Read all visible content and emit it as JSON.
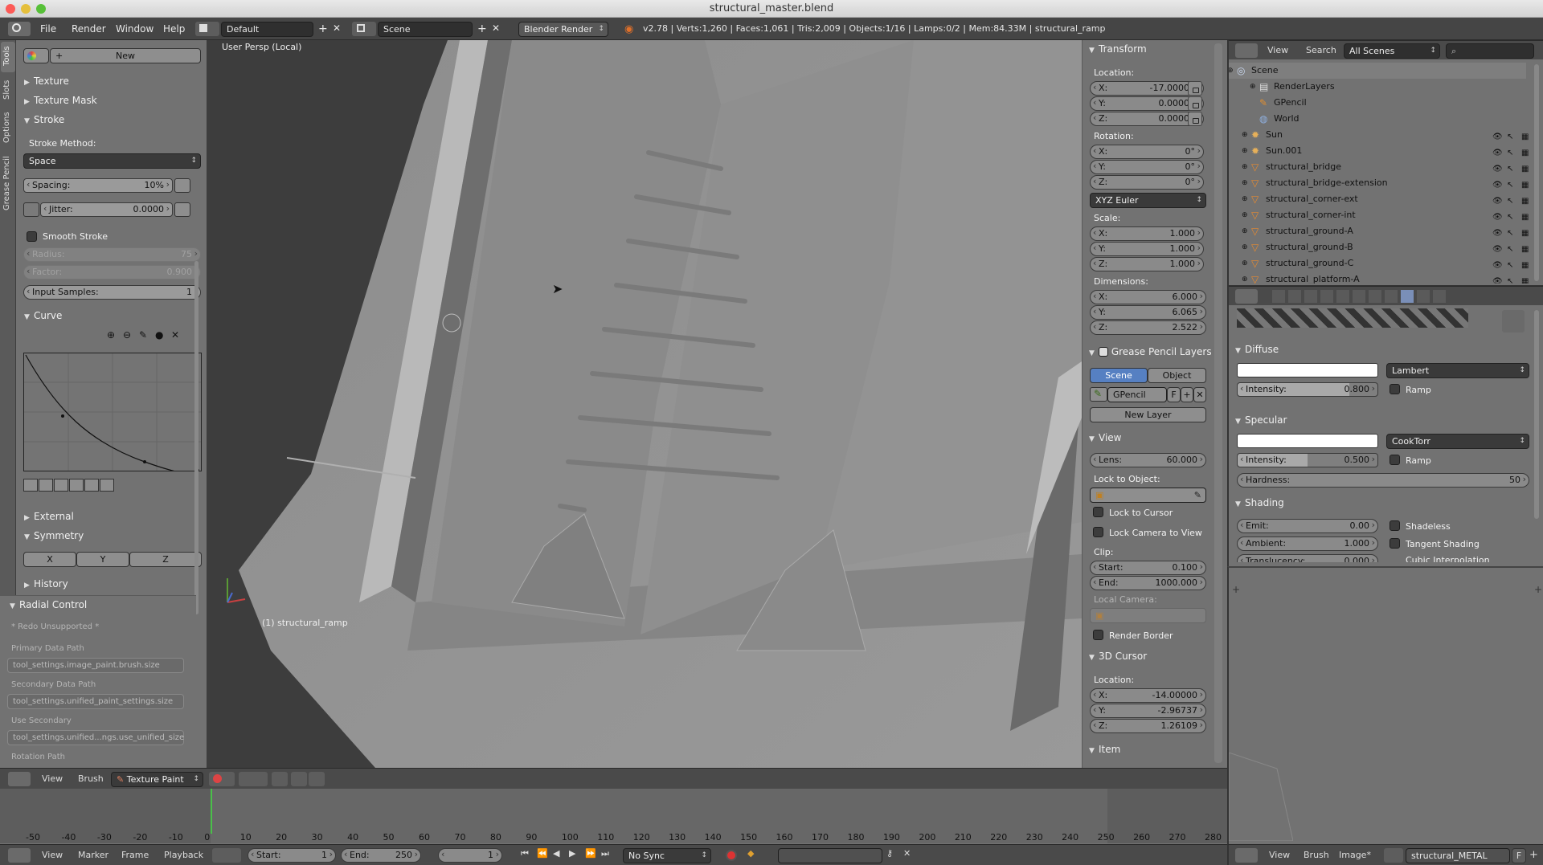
{
  "title": "structural_master.blend",
  "menu": {
    "items": [
      "File",
      "Render",
      "Window",
      "Help"
    ]
  },
  "screen_layout": "Default",
  "scene_name": "Scene",
  "render_engine": "Blender Render",
  "stats": "v2.78 | Verts:1,260 | Faces:1,061 | Tris:2,009 | Objects:1/16 | Lamps:0/2 | Mem:84.33M | structural_ramp",
  "tool_tabs": [
    "Tools",
    "Slots",
    "Options",
    "Grease Pencil"
  ],
  "toolshelf": {
    "new_button": "New",
    "texture": "Texture",
    "texture_mask": "Texture Mask",
    "stroke": "Stroke",
    "stroke_method_label": "Stroke Method:",
    "stroke_method": "Space",
    "spacing_label": "Spacing:",
    "spacing_value": "10%",
    "jitter_label": "Jitter:",
    "jitter_value": "0.0000",
    "smooth_stroke": "Smooth Stroke",
    "radius_label": "Radius:",
    "radius_value": "75",
    "factor_label": "Factor:",
    "factor_value": "0.900",
    "input_samples_label": "Input Samples:",
    "input_samples_value": "1",
    "curve": "Curve",
    "external": "External",
    "symmetry": "Symmetry",
    "sym_x": "X",
    "sym_y": "Y",
    "sym_z": "Z",
    "history": "History"
  },
  "radial": {
    "title": "Radial Control",
    "redo": "* Redo Unsupported *",
    "primary_label": "Primary Data Path",
    "primary_value": "tool_settings.image_paint.brush.size",
    "secondary_label": "Secondary Data Path",
    "secondary_value": "tool_settings.unified_paint_settings.size",
    "use_secondary_label": "Use Secondary",
    "use_secondary_value": "tool_settings.unified...ngs.use_unified_size",
    "rotation_label": "Rotation Path"
  },
  "viewport": {
    "view_label": "User Persp (Local)",
    "object_label": "(1) structural_ramp"
  },
  "properties": {
    "transform": "Transform",
    "location_label": "Location:",
    "loc": [
      {
        "a": "X:",
        "v": "-17.00000"
      },
      {
        "a": "Y:",
        "v": "0.00000"
      },
      {
        "a": "Z:",
        "v": "0.00000"
      }
    ],
    "rotation_label": "Rotation:",
    "rot": [
      {
        "a": "X:",
        "v": "0°"
      },
      {
        "a": "Y:",
        "v": "0°"
      },
      {
        "a": "Z:",
        "v": "0°"
      }
    ],
    "rotation_mode": "XYZ Euler",
    "scale_label": "Scale:",
    "scale": [
      {
        "a": "X:",
        "v": "1.000"
      },
      {
        "a": "Y:",
        "v": "1.000"
      },
      {
        "a": "Z:",
        "v": "1.000"
      }
    ],
    "dimensions_label": "Dimensions:",
    "dims": [
      {
        "a": "X:",
        "v": "6.000"
      },
      {
        "a": "Y:",
        "v": "6.065"
      },
      {
        "a": "Z:",
        "v": "2.522"
      }
    ],
    "gp_layers": "Grease Pencil Layers",
    "gp_scene": "Scene",
    "gp_object": "Object",
    "gp_name": "GPencil",
    "gp_f": "F",
    "new_layer": "New Layer",
    "view": "View",
    "lens_label": "Lens:",
    "lens_value": "60.000",
    "lock_to_object": "Lock to Object:",
    "lock_to_cursor": "Lock to Cursor",
    "lock_camera": "Lock Camera to View",
    "clip_label": "Clip:",
    "clip_start_label": "Start:",
    "clip_start": "0.100",
    "clip_end_label": "End:",
    "clip_end": "1000.000",
    "local_camera": "Local Camera:",
    "render_border": "Render Border",
    "cursor_3d": "3D Cursor",
    "cursor_location_label": "Location:",
    "cursor": [
      {
        "a": "X:",
        "v": "-14.00000"
      },
      {
        "a": "Y:",
        "v": "-2.96737"
      },
      {
        "a": "Z:",
        "v": "1.26109"
      }
    ],
    "item": "Item"
  },
  "outliner": {
    "view": "View",
    "search": "Search",
    "scope": "All Scenes",
    "items": [
      {
        "name": "Scene",
        "kind": "scene"
      },
      {
        "name": "RenderLayers",
        "kind": "layers"
      },
      {
        "name": "GPencil",
        "kind": "gpencil"
      },
      {
        "name": "World",
        "kind": "world"
      },
      {
        "name": "Sun",
        "kind": "lamp"
      },
      {
        "name": "Sun.001",
        "kind": "lamp"
      },
      {
        "name": "structural_bridge",
        "kind": "mesh"
      },
      {
        "name": "structural_bridge-extension",
        "kind": "mesh"
      },
      {
        "name": "structural_corner-ext",
        "kind": "mesh"
      },
      {
        "name": "structural_corner-int",
        "kind": "mesh"
      },
      {
        "name": "structural_ground-A",
        "kind": "mesh"
      },
      {
        "name": "structural_ground-B",
        "kind": "mesh"
      },
      {
        "name": "structural_ground-C",
        "kind": "mesh"
      },
      {
        "name": "structural_platform-A",
        "kind": "mesh"
      }
    ]
  },
  "material": {
    "diffuse": "Diffuse",
    "diffuse_shader": "Lambert",
    "diffuse_intensity_label": "Intensity:",
    "diffuse_intensity": "0.800",
    "ramp": "Ramp",
    "specular": "Specular",
    "specular_shader": "CookTorr",
    "specular_intensity_label": "Intensity:",
    "specular_intensity": "0.500",
    "hardness_label": "Hardness:",
    "hardness": "50",
    "shading": "Shading",
    "emit_label": "Emit:",
    "emit": "0.00",
    "shadeless": "Shadeless",
    "ambient_label": "Ambient:",
    "ambient": "1.000",
    "tangent_shading": "Tangent Shading",
    "translucency_label": "Translucency:",
    "translucency": "0.000",
    "cubic": "Cubic Interpolation"
  },
  "header3d": {
    "view": "View",
    "brush": "Brush",
    "mode": "Texture Paint"
  },
  "timeline": {
    "ticks": [
      "-50",
      "-40",
      "-30",
      "-20",
      "-10",
      "0",
      "10",
      "20",
      "30",
      "40",
      "50",
      "60",
      "70",
      "80",
      "90",
      "100",
      "110",
      "120",
      "130",
      "140",
      "150",
      "160",
      "170",
      "180",
      "190",
      "200",
      "210",
      "220",
      "230",
      "240",
      "250",
      "260",
      "270",
      "280"
    ],
    "view": "View",
    "marker": "Marker",
    "frame": "Frame",
    "playback": "Playback",
    "start_label": "Start:",
    "start": "1",
    "end_label": "End:",
    "end": "250",
    "current": "1",
    "sync": "No Sync"
  },
  "image_editor": {
    "view": "View",
    "brush": "Brush",
    "image": "Image*",
    "material_name": "structural_METAL",
    "f": "F"
  }
}
